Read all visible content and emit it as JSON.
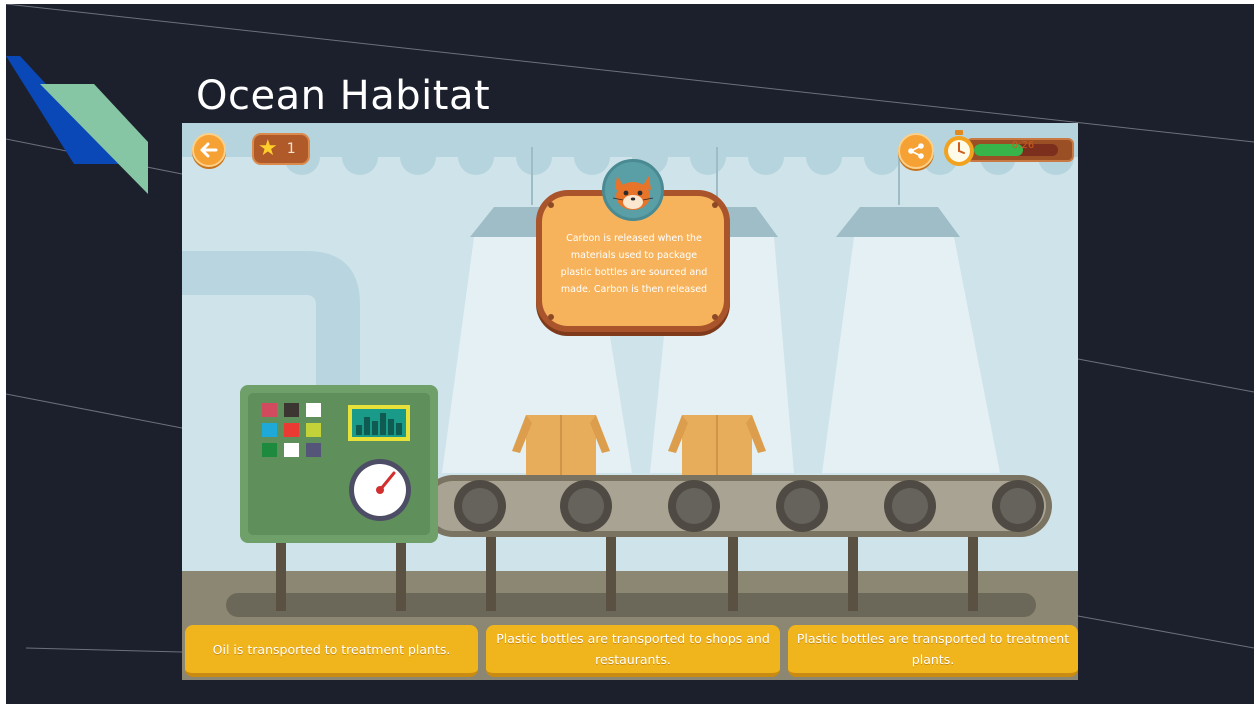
{
  "slide": {
    "title": "Ocean Habitat",
    "colors": {
      "background": "#1b202c",
      "accent_blue": "#0a48b8",
      "accent_green": "#86c6a4"
    }
  },
  "game": {
    "score": "1",
    "timer_text": "0:26",
    "timer_progress": 0.58,
    "speech": "Carbon is released when the materials used to package plastic bottles are sourced and made. Carbon is then released",
    "control_panel_colors": [
      "#d14a5e",
      "#3b3632",
      "#ffffff",
      "#1ea9d8",
      "#ea3a32",
      "#c4d23a",
      "#1d8a3e",
      "#ffffff",
      "#55557a"
    ],
    "answers": [
      "Oil is transported to treatment plants.",
      "Plastic bottles are transported to shops and restaurants.",
      "Plastic bottles are transported to treatment plants."
    ],
    "icons": {
      "back": "back-arrow-icon",
      "share": "share-icon",
      "score": "star-icon",
      "timer": "stopwatch-icon",
      "avatar": "fox-avatar"
    }
  }
}
